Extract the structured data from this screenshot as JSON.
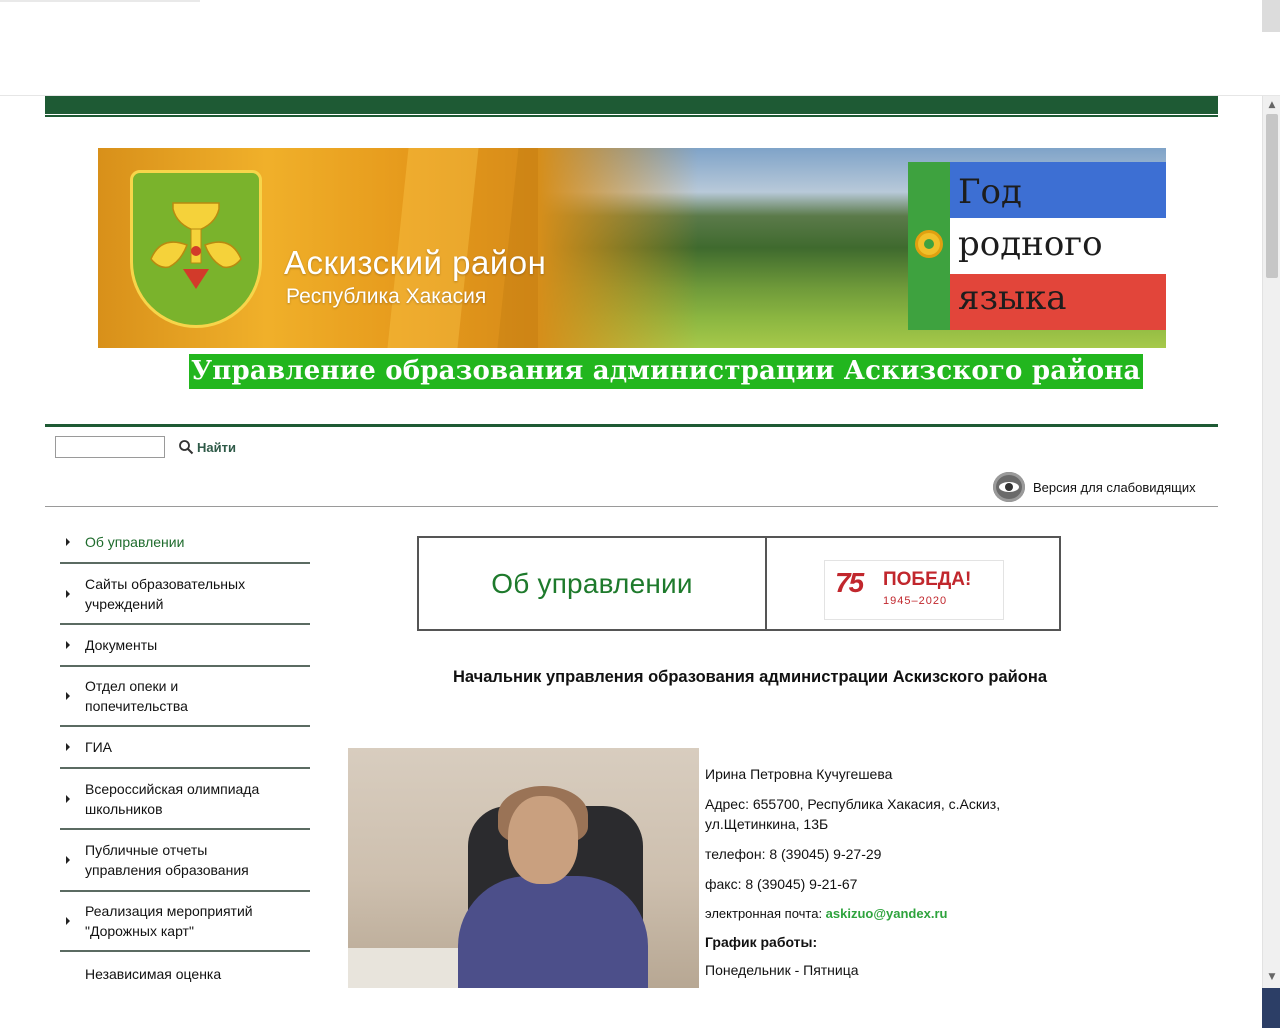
{
  "banner": {
    "district_title": "Аскизский район",
    "district_subtitle": "Республика Хакасия",
    "year_line1": "Год",
    "year_line2": "родного",
    "year_line3": "языка"
  },
  "org_title": "Управление образования администрации Аскизского района",
  "search": {
    "placeholder": "",
    "button_label": "Найти"
  },
  "accessibility": {
    "label": "Версия для слабовидящих"
  },
  "sidebar": {
    "items": [
      {
        "label": "Об управлении"
      },
      {
        "label": "Сайты образовательных учреждений"
      },
      {
        "label": "Документы"
      },
      {
        "label": "Отдел опеки и попечительства"
      },
      {
        "label": "ГИА"
      },
      {
        "label": "Всероссийская олимпиада школьников"
      },
      {
        "label": "Публичные отчеты управления образования"
      },
      {
        "label": "Реализация мероприятий \"Дорожных карт\""
      },
      {
        "label": "Независимая оценка"
      }
    ]
  },
  "tiles": {
    "about_label": "Об управлении",
    "pobeda_number": "75",
    "pobeda_word": "ПОБЕДА!",
    "pobeda_years": "1945–2020"
  },
  "main": {
    "head_title": "Начальник управления образования администрации Аскизского района",
    "name": "Ирина Петровна Кучугешева",
    "address": "Адрес: 655700, Республика Хакасия, с.Аскиз, ул.Щетинкина, 13Б",
    "phone": "телефон:  8 (39045) 9-27-29",
    "fax": "факс: 8 (39045) 9-21-67",
    "email_label": "электронная почта: ",
    "email": "askizuo@yandex.ru",
    "schedule_label": "График работы:",
    "schedule_days": "Понедельник - Пятница"
  }
}
